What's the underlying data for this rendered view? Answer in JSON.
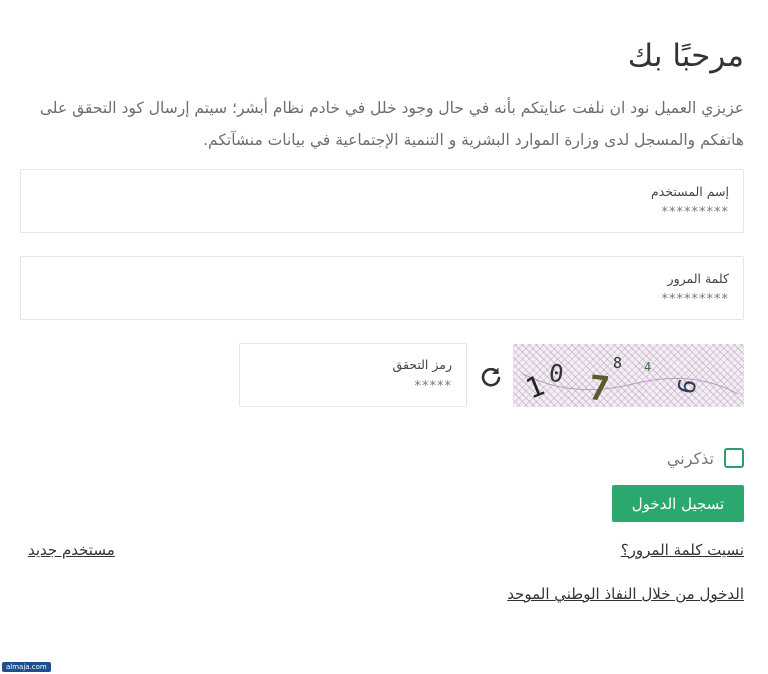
{
  "title": "مرحبًا بك",
  "intro": "عزيزي العميل نود ان نلفت عنايتكم بأنه في حال وجود خلل في خادم نظام أبشر؛ سيتم إرسال كود التحقق على هاتفكم والمسجل لدى وزارة الموارد البشرية و التنمية الإجتماعية في بيانات منشآتكم.",
  "username": {
    "label": "إسم المستخدم",
    "value": "*********"
  },
  "password": {
    "label": "كلمة المرور",
    "value": "*********"
  },
  "captcha": {
    "label": "رمز التحقق",
    "value": "*****",
    "digits": [
      "1",
      "0",
      "7",
      "8",
      "4",
      "6"
    ],
    "refresh_icon": "refresh-icon"
  },
  "remember": {
    "label": "تذكرني",
    "checked": false
  },
  "login_button": "تسجيل الدخول",
  "links": {
    "forgot_password": "نسيت كلمة المرور؟",
    "new_user": "مستخدم جديد",
    "nafath": "الدخول من خلال النفاذ الوطني الموحد"
  },
  "colors": {
    "accent": "#2ba86d",
    "checkbox_border": "#2e9e6e",
    "text": "#333333"
  },
  "watermark": "almaja.com"
}
